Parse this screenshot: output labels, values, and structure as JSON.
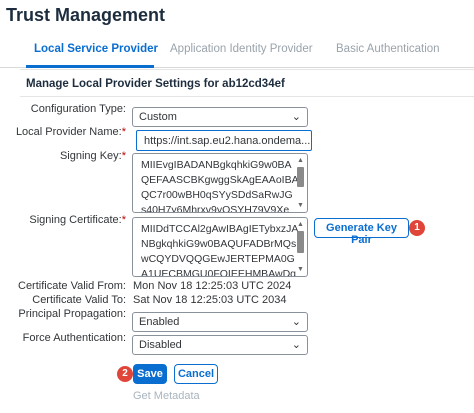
{
  "page": {
    "title": "Trust Management"
  },
  "tabs": [
    {
      "label": "Local Service Provider",
      "active": true
    },
    {
      "label": "Application Identity Provider",
      "active": false
    },
    {
      "label": "Basic Authentication",
      "active": false
    }
  ],
  "section": {
    "title": "Manage Local Provider Settings for ab12cd34ef"
  },
  "form": {
    "config_type": {
      "label": "Configuration Type:",
      "value": "Custom"
    },
    "provider_name": {
      "label": "Local Provider Name:",
      "value": "https://int.sap.eu2.hana.ondema..."
    },
    "signing_key": {
      "label": "Signing Key:",
      "lines": [
        "MIIEvgIBADANBgkqhkiG9w0BA",
        "QEFAASCBKgwggSkAgEAAoIBA",
        "QC7r00wBH0qSYySDdSaRwJG",
        "s40H7y6Mhrxv9yOSYH79V9Xe"
      ]
    },
    "signing_cert": {
      "label": "Signing Certificate:",
      "lines": [
        "MIIDdTCCAl2gAwIBAgIETybxzJA",
        "NBgkqhkiG9w0BAQUFADBrMQs",
        "wCQYDVQQGEwJERTEPMA0G",
        "A1UECBMGU0FOIEEHMBAwDg"
      ]
    },
    "generate_key_pair": "Generate Key Pair",
    "valid_from": {
      "label": "Certificate Valid From:",
      "value": "Mon Nov 18 12:25:03 UTC 2024"
    },
    "valid_to": {
      "label": "Certificate Valid To:",
      "value": "Sat Nov 18 12:25:03 UTC 2034"
    },
    "principal_propagation": {
      "label": "Principal Propagation:",
      "value": "Enabled"
    },
    "force_auth": {
      "label": "Force Authentication:",
      "value": "Disabled"
    }
  },
  "actions": {
    "save": "Save",
    "cancel": "Cancel",
    "get_metadata": "Get Metadata"
  },
  "markers": {
    "one": "1",
    "two": "2"
  },
  "icons": {
    "dropdown": "chevron-down-icon"
  },
  "colors": {
    "accent": "#0a6ed1",
    "marker": "#e0453a",
    "required": "#bb0000"
  }
}
